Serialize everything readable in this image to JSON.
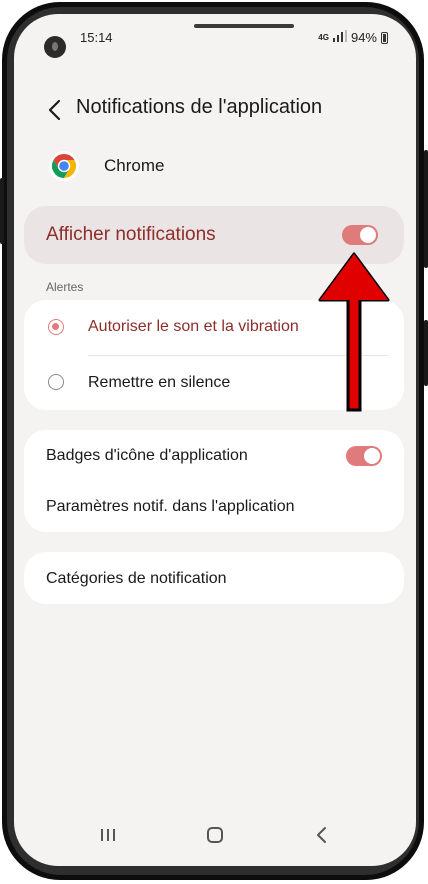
{
  "status_bar": {
    "time": "15:14",
    "network_label": "4G",
    "battery_text": "94%"
  },
  "header": {
    "title": "Notifications de l'application"
  },
  "app": {
    "name": "Chrome"
  },
  "main_toggle": {
    "label": "Afficher notifications",
    "enabled": true
  },
  "alerts": {
    "section_label": "Alertes",
    "options": [
      {
        "label": "Autoriser le son et la vibration",
        "selected": true
      },
      {
        "label": "Remettre en silence",
        "selected": false
      }
    ]
  },
  "settings_card": {
    "badges_label": "Badges d'icône d'application",
    "badges_enabled": true,
    "in_app_label": "Paramètres notif. dans l'application"
  },
  "categories_card": {
    "label": "Catégories de notification"
  },
  "colors": {
    "accent": "#e07b7b",
    "accent_text": "#8e2e2a",
    "annotation_arrow": "#e00000"
  },
  "navbar": {
    "recent_icon": "recent-apps-icon",
    "home_icon": "home-icon",
    "back_icon": "back-icon"
  }
}
